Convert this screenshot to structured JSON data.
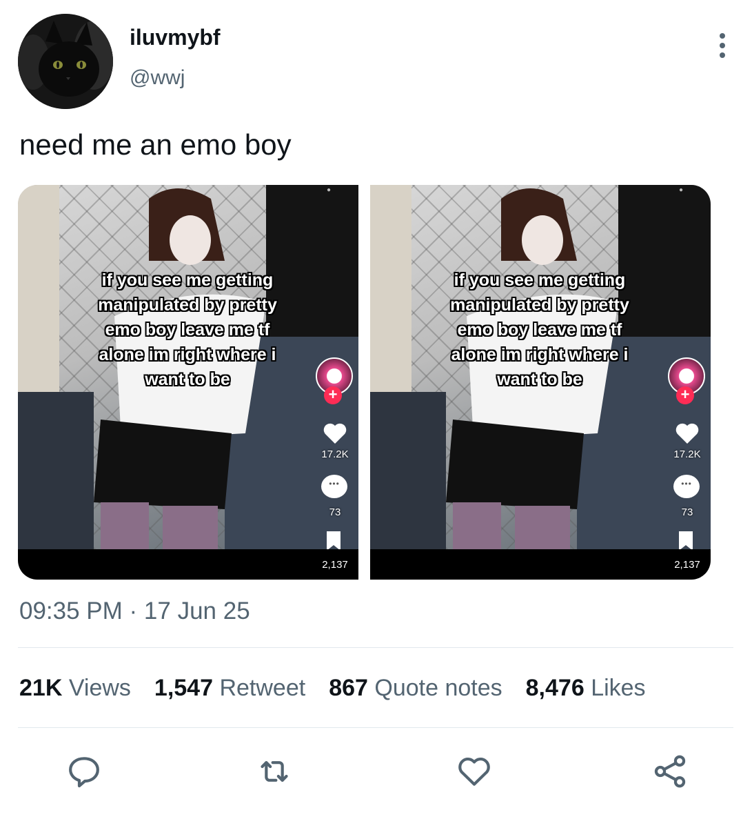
{
  "user": {
    "display_name": "iluvmybf",
    "handle": "@wwj"
  },
  "tweet": {
    "text": "need me an emo boy",
    "timestamp": "09:35 PM · 17 Jun 25"
  },
  "media": [
    {
      "overlay_text": "if you see me getting manipulated by pretty emo boy leave me tf alone im right where i want to be",
      "likes": "17.2K",
      "comments": "73",
      "bookmarks": "2,137"
    },
    {
      "overlay_text": "if you see me getting manipulated by pretty emo boy leave me tf alone im right where i want to be",
      "likes": "17.2K",
      "comments": "73",
      "bookmarks": "2,137"
    }
  ],
  "stats": {
    "views_count": "21K",
    "views_label": "Views",
    "retweet_count": "1,547",
    "retweet_label": "Retweet",
    "quote_count": "867",
    "quote_label": "Quote notes",
    "likes_count": "8,476",
    "likes_label": "Likes"
  },
  "icons": {
    "more": "more-vertical-icon",
    "reply": "reply-icon",
    "retweet": "retweet-icon",
    "like": "heart-icon",
    "share": "share-icon"
  },
  "colors": {
    "text_primary": "#0f1419",
    "text_secondary": "#536471",
    "divider": "#e1e8ed",
    "tiktok_plus": "#fe2c55"
  }
}
